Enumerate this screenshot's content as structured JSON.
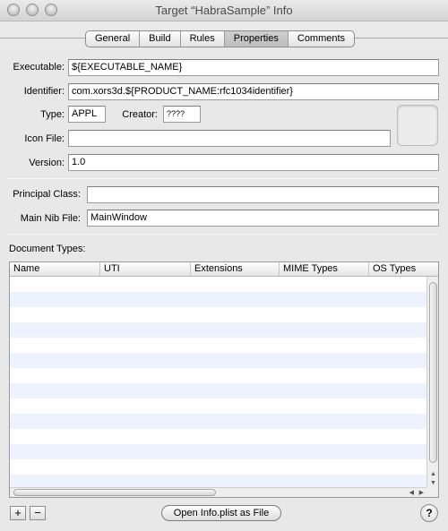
{
  "window": {
    "title": "Target “HabraSample” Info"
  },
  "tabs": [
    {
      "label": "General"
    },
    {
      "label": "Build"
    },
    {
      "label": "Rules"
    },
    {
      "label": "Properties",
      "active": true
    },
    {
      "label": "Comments"
    }
  ],
  "form": {
    "executable": {
      "label": "Executable:",
      "value": "${EXECUTABLE_NAME}"
    },
    "identifier": {
      "label": "Identifier:",
      "value": "com.xors3d.${PRODUCT_NAME:rfc1034identifier}"
    },
    "type": {
      "label": "Type:",
      "value": "APPL"
    },
    "creator": {
      "label": "Creator:",
      "value": "????"
    },
    "icon_file": {
      "label": "Icon File:",
      "value": ""
    },
    "version": {
      "label": "Version:",
      "value": "1.0"
    },
    "principal_class": {
      "label": "Principal Class:",
      "value": ""
    },
    "main_nib_file": {
      "label": "Main Nib File:",
      "value": "MainWindow"
    }
  },
  "document_types": {
    "label": "Document Types:",
    "columns": [
      "Name",
      "UTI",
      "Extensions",
      "MIME Types",
      "OS Types"
    ],
    "rows": []
  },
  "bottom": {
    "add_label": "+",
    "remove_label": "−",
    "open_plist_label": "Open Info.plist as File",
    "help_label": "?"
  }
}
